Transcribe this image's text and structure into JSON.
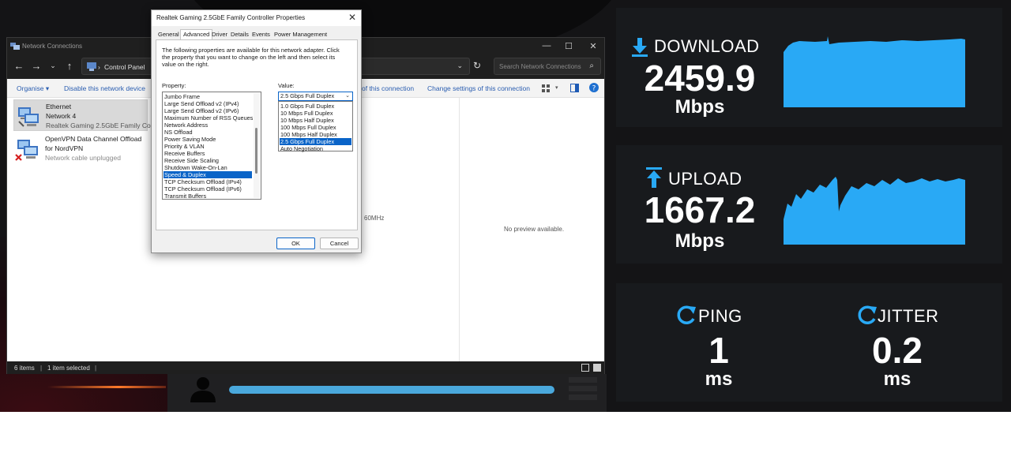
{
  "explorer": {
    "title": "Network Connections",
    "breadcrumb_sep": "›",
    "breadcrumb": "Control Panel",
    "search_placeholder": "Search Network Connections",
    "toolbar": {
      "organise": "Organise ▾",
      "disable": "Disable this network device",
      "partial_connection": "of this connection",
      "change_settings": "Change settings of this connection"
    },
    "items": [
      {
        "name": "Ethernet",
        "network": "Network 4",
        "adapter": "Realtek Gaming 2.5GbE Family Co..."
      },
      {
        "name": "OpenVPN Data Channel Offload",
        "network": "for NordVPN",
        "adapter": "Network cable unplugged"
      }
    ],
    "hidden_fragment": "60MHz",
    "preview_text": "No preview available.",
    "status": {
      "items_count": "6 items",
      "selected": "1 item selected"
    }
  },
  "dialog": {
    "title": "Realtek Gaming 2.5GbE Family Controller Properties",
    "tabs": [
      "General",
      "Advanced",
      "Driver",
      "Details",
      "Events",
      "Power Management"
    ],
    "active_tab": "Advanced",
    "description": "The following properties are available for this network adapter. Click the property that you want to change on the left and then select its value on the right.",
    "property_label": "Property:",
    "value_label": "Value:",
    "properties": [
      "Jumbo Frame",
      "Large Send Offload v2 (IPv4)",
      "Large Send Offload v2 (IPv6)",
      "Maximum Number of RSS Queues",
      "Network Address",
      "NS Offload",
      "Power Saving Mode",
      "Priority & VLAN",
      "Receive Buffers",
      "Receive Side Scaling",
      "Shutdown Wake-On-Lan",
      "Speed & Duplex",
      "TCP Checksum Offload (IPv4)",
      "TCP Checksum Offload (IPv6)",
      "Transmit Buffers"
    ],
    "selected_property": "Speed & Duplex",
    "selected_value": "2.5 Gbps Full Duplex",
    "value_options": [
      "1.0 Gbps Full Duplex",
      "10 Mbps Full Duplex",
      "10 Mbps Half Duplex",
      "100 Mbps Full Duplex",
      "100 Mbps Half Duplex",
      "2.5 Gbps Full Duplex",
      "Auto Negotiation"
    ],
    "ok_label": "OK",
    "cancel_label": "Cancel"
  },
  "speedtest": {
    "download": {
      "label": "DOWNLOAD",
      "value": "2459.9",
      "unit": "Mbps"
    },
    "upload": {
      "label": "UPLOAD",
      "value": "1667.2",
      "unit": "Mbps"
    },
    "ping": {
      "label": "PING",
      "value": "1",
      "unit": "ms"
    },
    "jitter": {
      "label": "JITTER",
      "value": "0.2",
      "unit": "ms"
    },
    "progress_fraction": 1.0,
    "accent_color": "#29a9f5"
  }
}
